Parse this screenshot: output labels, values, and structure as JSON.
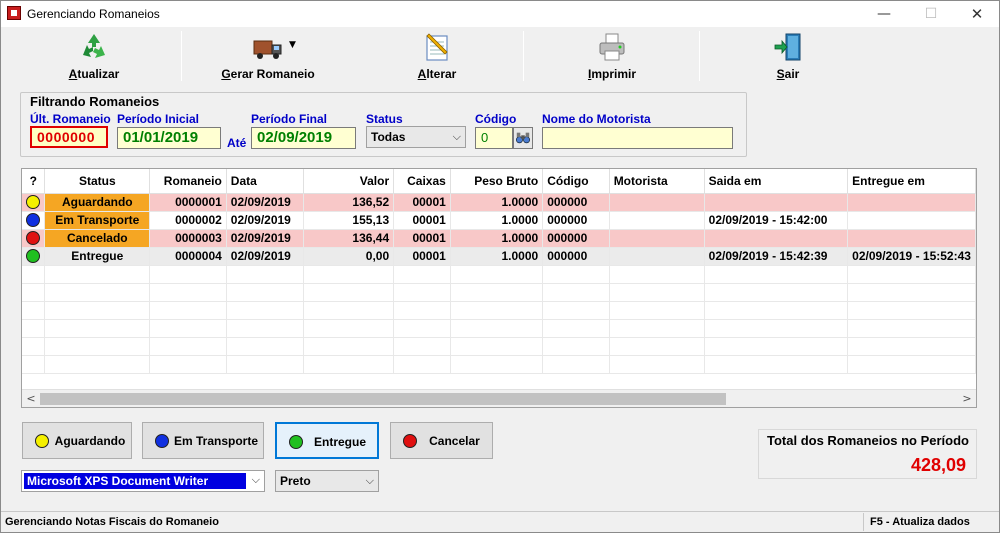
{
  "window": {
    "title": "Gerenciando Romaneios",
    "min": "—",
    "max": "☐",
    "close": "✕"
  },
  "toolbar": {
    "buttons": [
      {
        "label_key": "A",
        "label_rest": "tualizar",
        "icon": "recycle-icon"
      },
      {
        "label_key": "G",
        "label_rest": "erar Romaneio",
        "icon": "truck-icon"
      },
      {
        "label_key": "A",
        "label_rest": "lterar",
        "icon": "notepad-pencil-icon"
      },
      {
        "label_key": "I",
        "label_rest": "mprimir",
        "icon": "printer-icon"
      },
      {
        "label_key": "S",
        "label_rest": "air",
        "icon": "exit-door-icon"
      }
    ]
  },
  "filter": {
    "title": "Filtrando Romaneios",
    "ult_romaneio_label": "Últ. Romaneio",
    "ult_romaneio_value": "0000000",
    "periodo_inicial_label": "Período Inicial",
    "periodo_inicial_value": "01/01/2019",
    "ate_label": "Até",
    "periodo_final_label": "Período Final",
    "periodo_final_value": "02/09/2019",
    "status_label": "Status",
    "status_value": "Todas",
    "codigo_label": "Código",
    "codigo_value": "0",
    "motorista_label": "Nome do Motorista",
    "motorista_value": ""
  },
  "grid": {
    "columns": [
      "?",
      "Status",
      "Romaneio",
      "Data",
      "Valor",
      "Caixas",
      "Peso Bruto",
      "Código",
      "Motorista",
      "Saida em",
      "Entregue em"
    ],
    "rows": [
      {
        "dot_color": "#f5f000",
        "status": "Aguardando",
        "romaneio": "0000001",
        "data": "02/09/2019",
        "valor": "136,52",
        "caixas": "00001",
        "peso": "1.0000",
        "codigo": "000000",
        "motorista": "",
        "saida": "",
        "entregue": "",
        "row_style": "pink",
        "status_orange": true
      },
      {
        "dot_color": "#1030e0",
        "status": "Em Transporte",
        "romaneio": "0000002",
        "data": "02/09/2019",
        "valor": "155,13",
        "caixas": "00001",
        "peso": "1.0000",
        "codigo": "000000",
        "motorista": "",
        "saida": "02/09/2019 - 15:42:00",
        "entregue": "",
        "row_style": "white",
        "status_orange": true
      },
      {
        "dot_color": "#e01010",
        "status": "Cancelado",
        "romaneio": "0000003",
        "data": "02/09/2019",
        "valor": "136,44",
        "caixas": "00001",
        "peso": "1.0000",
        "codigo": "000000",
        "motorista": "",
        "saida": "",
        "entregue": "",
        "row_style": "pink",
        "status_orange": true
      },
      {
        "dot_color": "#20c020",
        "status": "Entregue",
        "romaneio": "0000004",
        "data": "02/09/2019",
        "valor": "0,00",
        "caixas": "00001",
        "peso": "1.0000",
        "codigo": "000000",
        "motorista": "",
        "saida": "02/09/2019 - 15:42:39",
        "entregue": "02/09/2019 - 15:52:43",
        "row_style": "grey",
        "status_orange": false
      }
    ],
    "empty_rows": 6,
    "scroll_left": "<",
    "scroll_right": ">"
  },
  "actions": [
    {
      "label": "Aguardando",
      "dot_color": "#f5f000"
    },
    {
      "label": "Em Transporte",
      "dot_color": "#1030e0"
    },
    {
      "label": "Entregue",
      "dot_color": "#20c020"
    },
    {
      "label": "Cancelar",
      "dot_color": "#e01010"
    }
  ],
  "total": {
    "label": "Total dos Romaneios no Período",
    "value": "428,09"
  },
  "printer": {
    "selected": "Microsoft XPS Document Writer",
    "color_mode": "Preto"
  },
  "statusbar": {
    "left": "Gerenciando Notas Fiscais do Romaneio",
    "right": "F5 - Atualiza dados"
  }
}
